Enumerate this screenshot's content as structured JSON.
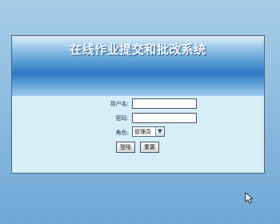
{
  "header": {
    "title": "在线作业提交和批改系统"
  },
  "form": {
    "username_label": "用户名:",
    "username_value": "",
    "password_label": "密码:",
    "password_value": "",
    "role_label": "角色:",
    "role_selected": "管理员",
    "login_button": "登陆",
    "reset_button": "重置"
  },
  "icons": {
    "dropdown": "chevron-down-icon",
    "cursor": "mouse-cursor-icon"
  },
  "colors": {
    "page_background": "#8dbde0",
    "panel_background": "#d6eef7",
    "header_blue": "#2d79c4"
  }
}
